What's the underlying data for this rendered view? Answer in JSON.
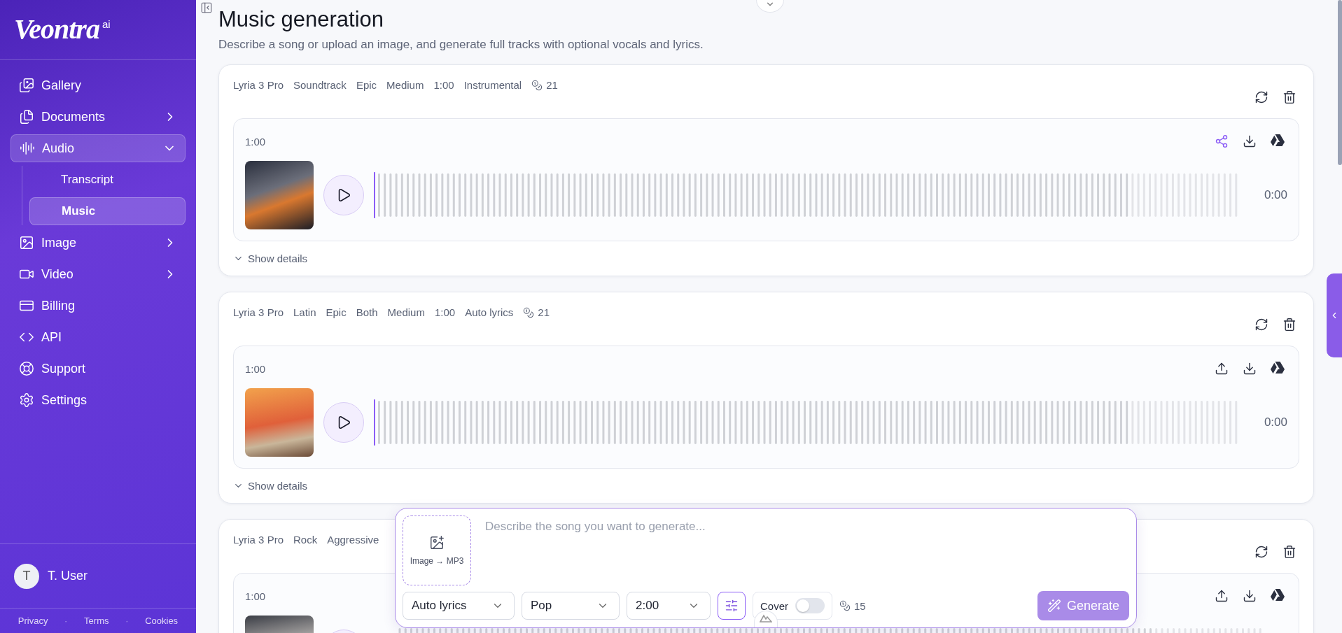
{
  "sidebar": {
    "logo": "Veontra",
    "logo_badge": "ai",
    "items": [
      {
        "label": "Gallery",
        "kind": "gallery",
        "selected": false
      },
      {
        "label": "Documents",
        "kind": "documents",
        "expanded": false,
        "selected": false
      },
      {
        "label": "Audio",
        "kind": "audio",
        "expanded": true,
        "selected": true,
        "children": [
          {
            "label": "Transcript",
            "selected": false
          },
          {
            "label": "Music",
            "selected": true
          }
        ]
      },
      {
        "label": "Image",
        "kind": "image",
        "expanded": false,
        "selected": false
      },
      {
        "label": "Video",
        "kind": "video",
        "expanded": false,
        "selected": false
      },
      {
        "label": "Billing",
        "kind": "billing",
        "selected": false
      },
      {
        "label": "API",
        "kind": "api",
        "selected": false
      },
      {
        "label": "Support",
        "kind": "support",
        "selected": false
      },
      {
        "label": "Settings",
        "kind": "settings",
        "selected": false
      }
    ],
    "user": {
      "initial": "T",
      "name": "T. User"
    },
    "footer_links": [
      "Privacy",
      "Terms",
      "Cookies"
    ],
    "footer_separator": "·"
  },
  "header": {
    "title": "Music generation",
    "subtitle": "Describe a song or upload an image, and generate full tracks with optional vocals and lyrics."
  },
  "cards": [
    {
      "tags": [
        "Lyria 3 Pro",
        "Soundtrack",
        "Epic",
        "Medium",
        "1:00",
        "Instrumental"
      ],
      "credits": "21",
      "track": {
        "duration": "1:00",
        "time": "0:00",
        "shared": true
      },
      "details": {
        "label": "Show details",
        "expanded": false
      }
    },
    {
      "tags": [
        "Lyria 3 Pro",
        "Latin",
        "Epic",
        "Both",
        "Medium",
        "1:00",
        "Auto lyrics"
      ],
      "credits": "21",
      "track": {
        "duration": "1:00",
        "time": "0:00",
        "shared": false
      },
      "details": {
        "label": "Show details",
        "expanded": false
      }
    },
    {
      "tags": [
        "Lyria 3 Pro",
        "Rock",
        "Aggressive"
      ],
      "track": {
        "duration": "1:00",
        "shared": false
      }
    }
  ],
  "composer": {
    "upload_label": "Image → MP3",
    "placeholder": "Describe the song you want to generate...",
    "selects": [
      "Auto lyrics",
      "Pop",
      "2:00"
    ],
    "advanced_active": true,
    "cover": {
      "label": "Cover",
      "on": false
    },
    "credits": "15",
    "generate": "Generate"
  }
}
